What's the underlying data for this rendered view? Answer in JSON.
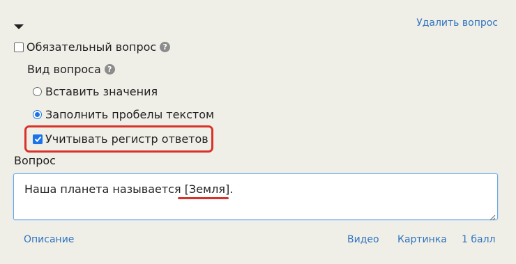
{
  "header": {
    "delete_label": "Удалить вопрос"
  },
  "required": {
    "label": "Обязательный вопрос",
    "checked": false
  },
  "question_type": {
    "label": "Вид вопроса",
    "options": [
      {
        "label": "Вставить значения",
        "selected": false
      },
      {
        "label": "Заполнить пробелы текстом",
        "selected": true
      }
    ]
  },
  "case_sensitive": {
    "label": "Учитывать регистр ответов",
    "checked": true
  },
  "question": {
    "label": "Вопрос",
    "text": "Наша планета называется [Земля]."
  },
  "footer": {
    "description": "Описание",
    "video": "Видео",
    "image": "Картинка",
    "score": "1 балл"
  },
  "colors": {
    "link": "#2f74c0",
    "highlight": "#d9322b",
    "accent": "#1a73e8",
    "background": "#f0efe7"
  }
}
